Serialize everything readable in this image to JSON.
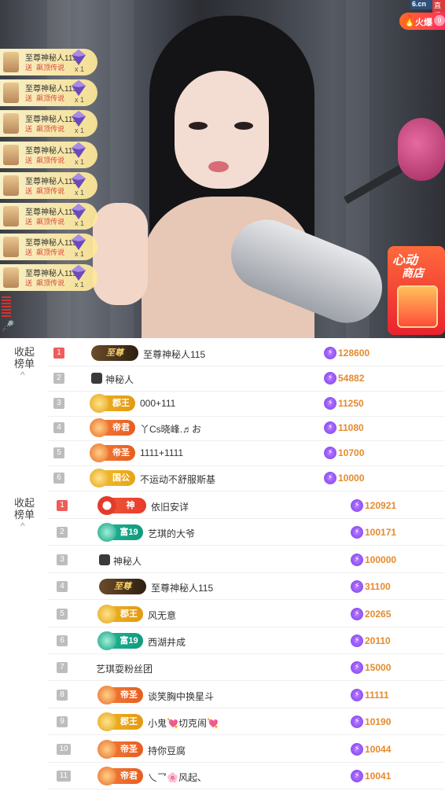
{
  "stream": {
    "site_label": "6.cn",
    "live_label": "直播",
    "hot_label": "火爆",
    "hot_count": "9",
    "shop_title_1": "心动",
    "shop_title_2": "商店"
  },
  "gift_notices": [
    {
      "name": "至尊神秘人115",
      "send": "送",
      "gift": "飙顶传说",
      "count": "x 1"
    },
    {
      "name": "至尊神秘人115",
      "send": "送",
      "gift": "飙顶传说",
      "count": "x 1"
    },
    {
      "name": "至尊神秘人115",
      "send": "送",
      "gift": "飙顶传说",
      "count": "x 1"
    },
    {
      "name": "至尊神秘人115",
      "send": "送",
      "gift": "飙顶传说",
      "count": "x 1"
    },
    {
      "name": "至尊神秘人115",
      "send": "送",
      "gift": "飙顶传说",
      "count": "x 1"
    },
    {
      "name": "至尊神秘人115",
      "send": "送",
      "gift": "飙顶传说",
      "count": "x 1"
    },
    {
      "name": "至尊神秘人115",
      "send": "送",
      "gift": "飙顶传说",
      "count": "x 1"
    },
    {
      "name": "至尊神秘人115",
      "send": "送",
      "gift": "飙顶传说",
      "count": "x 1"
    }
  ],
  "rank1": {
    "toggle_label": "收起榜单",
    "rows": [
      {
        "rank": "1",
        "badge": "至尊",
        "name": "至尊神秘人115",
        "score": "128600"
      },
      {
        "rank": "2",
        "badge": "",
        "name": "神秘人",
        "score": "54882"
      },
      {
        "rank": "3",
        "badge": "郡王",
        "name": "000+111",
        "score": "11250"
      },
      {
        "rank": "4",
        "badge": "帝君",
        "name": "丫Cs晓峰.♬お",
        "score": "11080"
      },
      {
        "rank": "5",
        "badge": "帝圣",
        "name": "1111+1111",
        "score": "10700"
      },
      {
        "rank": "6",
        "badge": "国公",
        "name": "不运动不舒服斯基",
        "score": "10000"
      }
    ]
  },
  "rank2": {
    "toggle_label": "收起榜单",
    "rows": [
      {
        "rank": "1",
        "badge": "神",
        "name": "依旧安详",
        "score": "120921"
      },
      {
        "rank": "2",
        "badge": "富19",
        "name": "艺琪的大爷",
        "score": "100171"
      },
      {
        "rank": "3",
        "badge": "",
        "name": "神秘人",
        "score": "100000"
      },
      {
        "rank": "4",
        "badge": "至尊",
        "name": "至尊神秘人115",
        "score": "31100"
      },
      {
        "rank": "5",
        "badge": "郡王",
        "name": "风无意",
        "score": "20265"
      },
      {
        "rank": "6",
        "badge": "富19",
        "name": "西湖井成",
        "score": "20110"
      },
      {
        "rank": "7",
        "badge": "",
        "name": "艺琪耍粉丝团",
        "score": "15000"
      },
      {
        "rank": "8",
        "badge": "帝圣",
        "name": "谈笑胸中换星斗",
        "score": "11111"
      },
      {
        "rank": "9",
        "badge": "郡王",
        "name": "小鬼💘切克闹💘",
        "score": "10190"
      },
      {
        "rank": "10",
        "badge": "帝圣",
        "name": "持你豆腐",
        "score": "10044"
      },
      {
        "rank": "11",
        "badge": "帝君",
        "name": "乀乛🌸风起、",
        "score": "10041"
      }
    ]
  },
  "colors": {
    "score": "#e58a2d",
    "rank_first": "#ee5c5c",
    "rank_other": "#bdbdbd",
    "bolt": "#7f3df0"
  },
  "icons": {
    "bolt": "⚡",
    "mystery": "mystery-person-icon",
    "mic": "🎤",
    "caret": "^"
  }
}
